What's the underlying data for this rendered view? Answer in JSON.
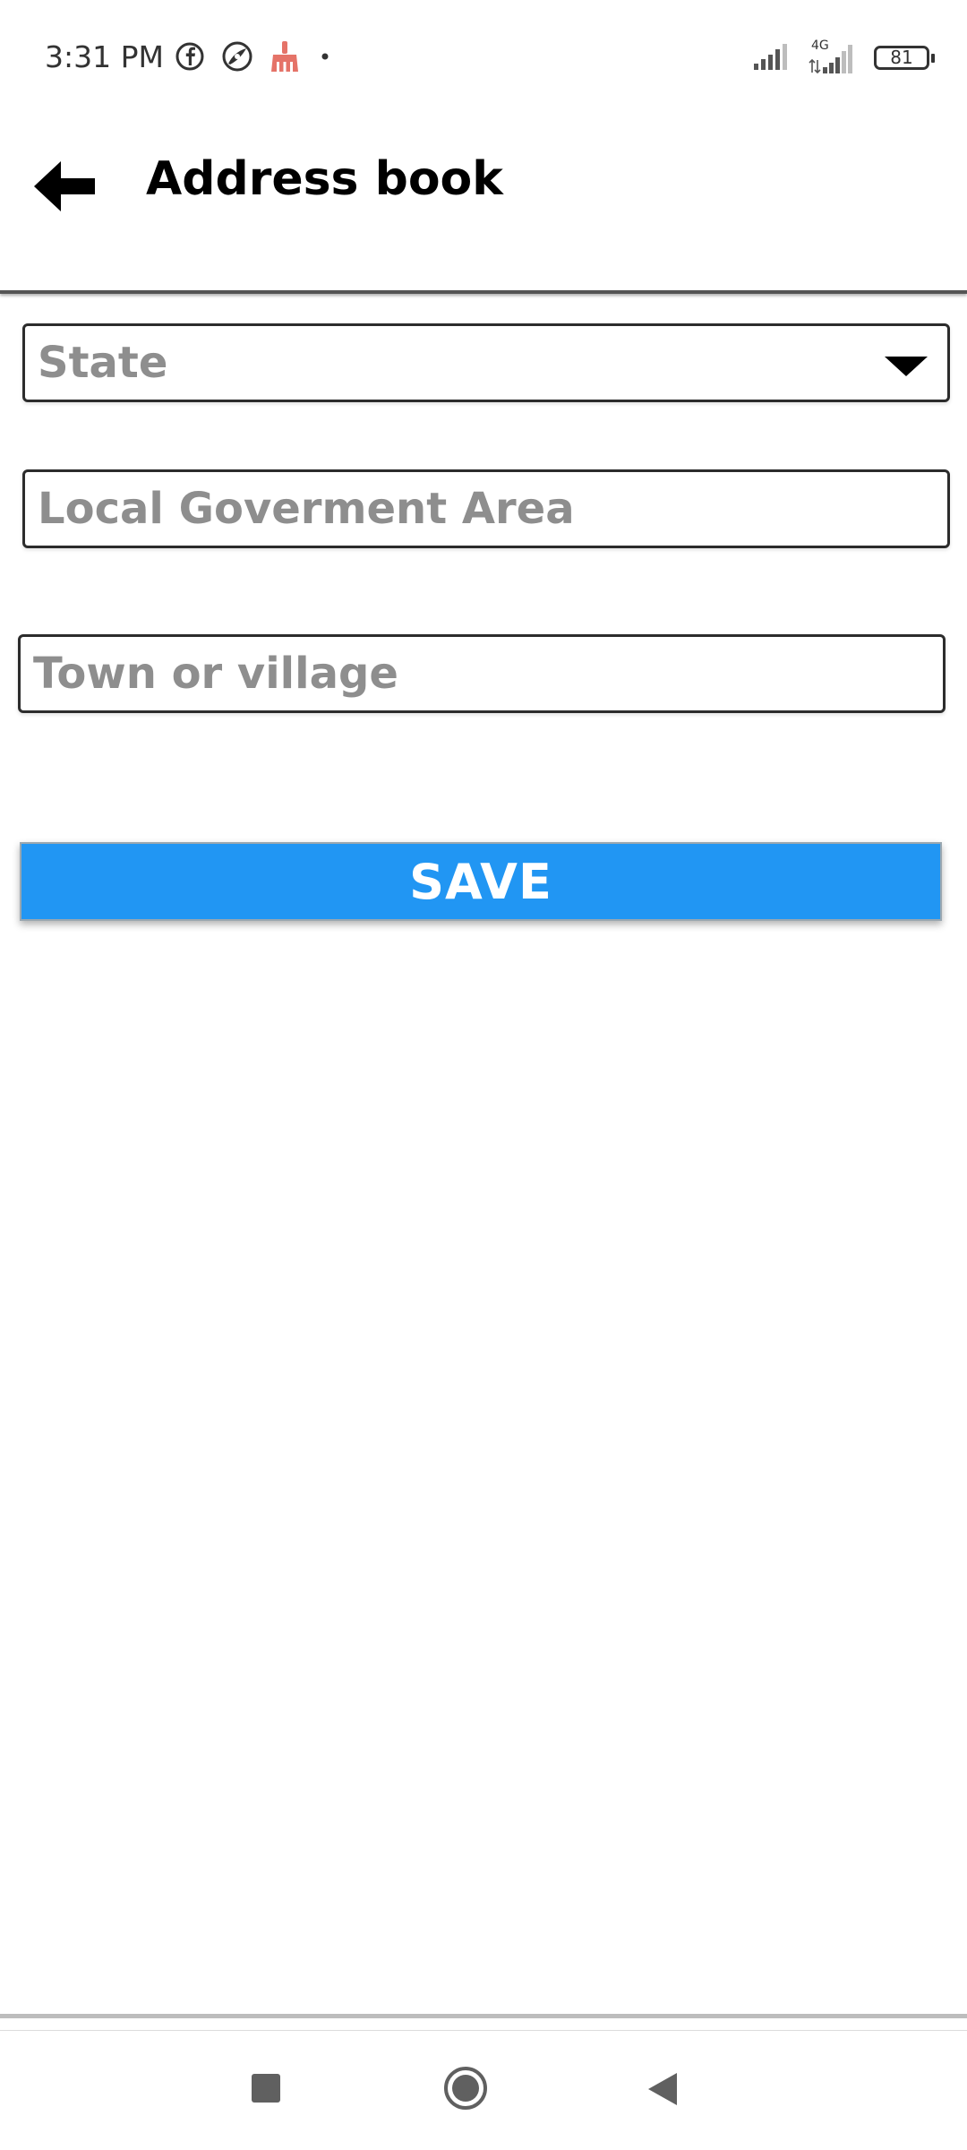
{
  "status_bar": {
    "time": "3:31 PM",
    "left_icons": [
      "facebook-icon",
      "browser-icon",
      "cleaner-icon",
      "notification-dot-icon"
    ],
    "right_icons": [
      "signal-icon",
      "4g-signal-icon",
      "battery-icon"
    ],
    "network_label": "4G",
    "battery_level": "81"
  },
  "app_bar": {
    "title": "Address book",
    "back_icon": "arrow-left-icon"
  },
  "form": {
    "state": {
      "placeholder": "State",
      "icon": "dropdown-arrow-icon"
    },
    "lga": {
      "placeholder": "Local Goverment Area"
    },
    "town": {
      "placeholder": "Town or village"
    },
    "save_label": "SAVE"
  },
  "colors": {
    "accent": "#2196f3",
    "placeholder": "#8e8e8e",
    "cleaner_icon": "#e57368"
  },
  "nav_bar": {
    "icons": [
      "recents-square-icon",
      "home-circle-icon",
      "back-triangle-icon"
    ]
  }
}
